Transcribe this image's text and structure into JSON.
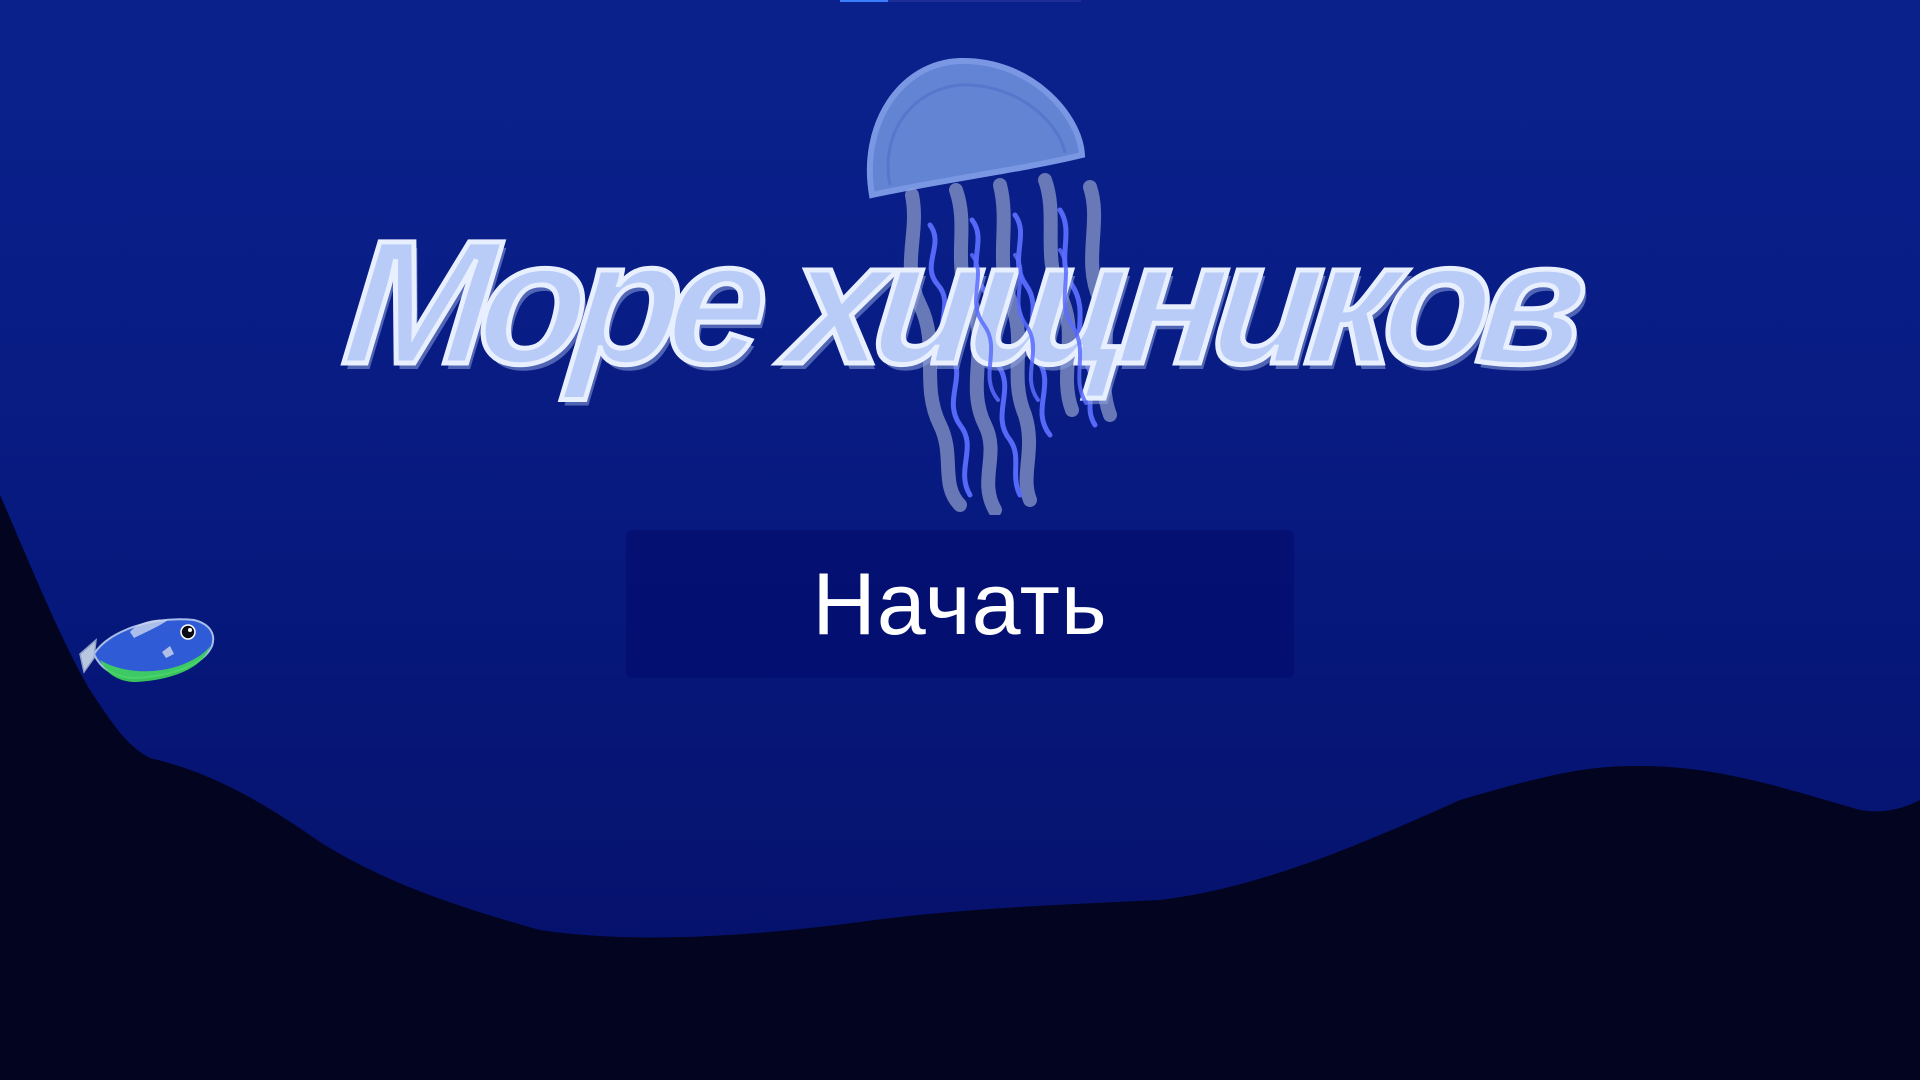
{
  "game": {
    "title": "Море хищников",
    "start_button_label": "Начать"
  },
  "loading_progress": 0.2,
  "sprites": {
    "mascot": "jellyfish",
    "player": "fish"
  },
  "colors": {
    "water_top": "#0a218c",
    "water_bottom": "#050f66",
    "seabed": "#03041f",
    "title_fill": "#b9ccf7",
    "title_outline": "#e8efff",
    "button_bg": "#040e6e",
    "button_text": "#ffffff",
    "jellyfish_bell": "#6d8fdc",
    "jellyfish_tentacles": "#5b6dff",
    "fish_body": "#2f5bd6",
    "fish_belly": "#3fd65a"
  }
}
